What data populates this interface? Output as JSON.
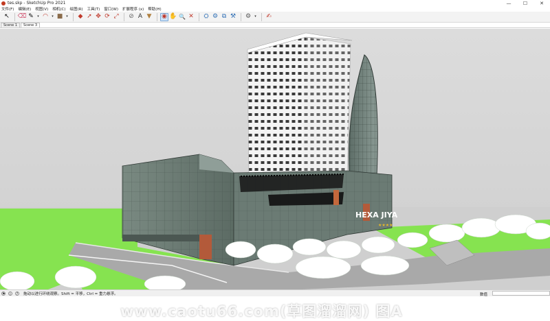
{
  "window": {
    "title": "tes.skp - SketchUp Pro 2021",
    "minimize": "—",
    "maximize": "☐",
    "close": "✕"
  },
  "menu": [
    "文件(F)",
    "编辑(E)",
    "视图(V)",
    "相机(C)",
    "绘图(R)",
    "工具(T)",
    "窗口(W)",
    "扩展程序 (x)",
    "帮助(H)"
  ],
  "toolbar": {
    "tools": [
      {
        "name": "select-icon",
        "glyph": "↖"
      },
      {
        "name": "eraser-icon",
        "glyph": "⌫"
      },
      {
        "name": "pencil-icon",
        "glyph": "✎"
      },
      {
        "name": "arc-icon",
        "glyph": "◠"
      },
      {
        "name": "shape-icon",
        "glyph": "■"
      },
      {
        "name": "push-pull-icon",
        "glyph": "◆"
      },
      {
        "name": "follow-me-icon",
        "glyph": "➚"
      },
      {
        "name": "move-icon",
        "glyph": "✥"
      },
      {
        "name": "rotate-icon",
        "glyph": "⟳"
      },
      {
        "name": "scale-icon",
        "glyph": "⤢"
      },
      {
        "name": "tape-measure-icon",
        "glyph": "⊘"
      },
      {
        "name": "text-icon",
        "glyph": "A"
      },
      {
        "name": "paint-bucket-icon",
        "glyph": "▼"
      },
      {
        "name": "orbit-icon",
        "glyph": "◉"
      },
      {
        "name": "pan-icon",
        "glyph": "✋"
      },
      {
        "name": "zoom-icon",
        "glyph": "🔍"
      },
      {
        "name": "zoom-extents-icon",
        "glyph": "✕"
      },
      {
        "name": "3d-warehouse-icon",
        "glyph": "⛭"
      },
      {
        "name": "extension-warehouse-icon",
        "glyph": "⚙"
      },
      {
        "name": "layout-icon",
        "glyph": "⧉"
      },
      {
        "name": "extension-manager-icon",
        "glyph": "⚒"
      },
      {
        "name": "settings-icon",
        "glyph": "⚙"
      },
      {
        "name": "notepad-icon",
        "glyph": "✍"
      }
    ]
  },
  "scenes": [
    "Scene 1",
    "Scene 3"
  ],
  "status": {
    "text": "拖动以进行环绕观察。Shift = 平移，Ctrl = 重力悬浮。",
    "measurements_label": "数值",
    "measurements_value": ""
  },
  "model": {
    "sign_text": "HEXA JIYA",
    "sign_stars": "★★★★",
    "watermark": "www.caotu66.com(草图溜溜网) 图A"
  },
  "colors": {
    "sky": "#d5d5d5",
    "ground": "#cfcfcf",
    "grass": "#7ee04a",
    "glass": "#6a7a72",
    "tower": "#f2f2f2",
    "accent": "#b14c2f"
  }
}
